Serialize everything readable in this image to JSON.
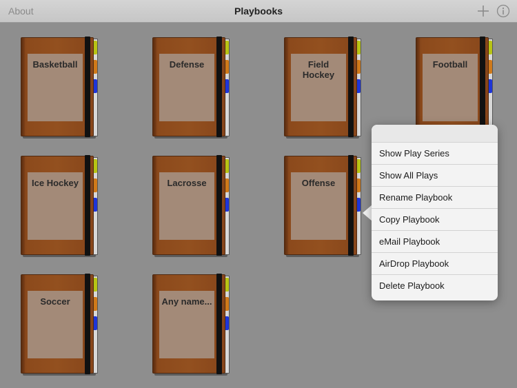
{
  "navbar": {
    "about_label": "About",
    "title": "Playbooks",
    "add_icon": "plus-icon",
    "info_icon": "info-icon"
  },
  "playbooks": [
    {
      "name": "Basketball"
    },
    {
      "name": "Defense"
    },
    {
      "name": "Field\nHockey"
    },
    {
      "name": "Football"
    },
    {
      "name": "Ice Hockey"
    },
    {
      "name": "Lacrosse"
    },
    {
      "name": "Offense"
    },
    {
      "name": "Soccer"
    },
    {
      "name": "Any name..."
    }
  ],
  "popover": {
    "items": [
      {
        "label": "Show Play Series"
      },
      {
        "label": "Show All Plays"
      },
      {
        "label": "Rename Playbook"
      },
      {
        "label": "Copy Playbook"
      },
      {
        "label": "eMail Playbook"
      },
      {
        "label": "AirDrop Playbook"
      },
      {
        "label": "Delete Playbook"
      }
    ]
  },
  "colors": {
    "background": "#8e8e8e",
    "cover": "#93501f",
    "label": "#a38a78",
    "tab_yellow": "#b8c414",
    "tab_orange": "#d07a1a",
    "tab_blue": "#1e35d8"
  }
}
